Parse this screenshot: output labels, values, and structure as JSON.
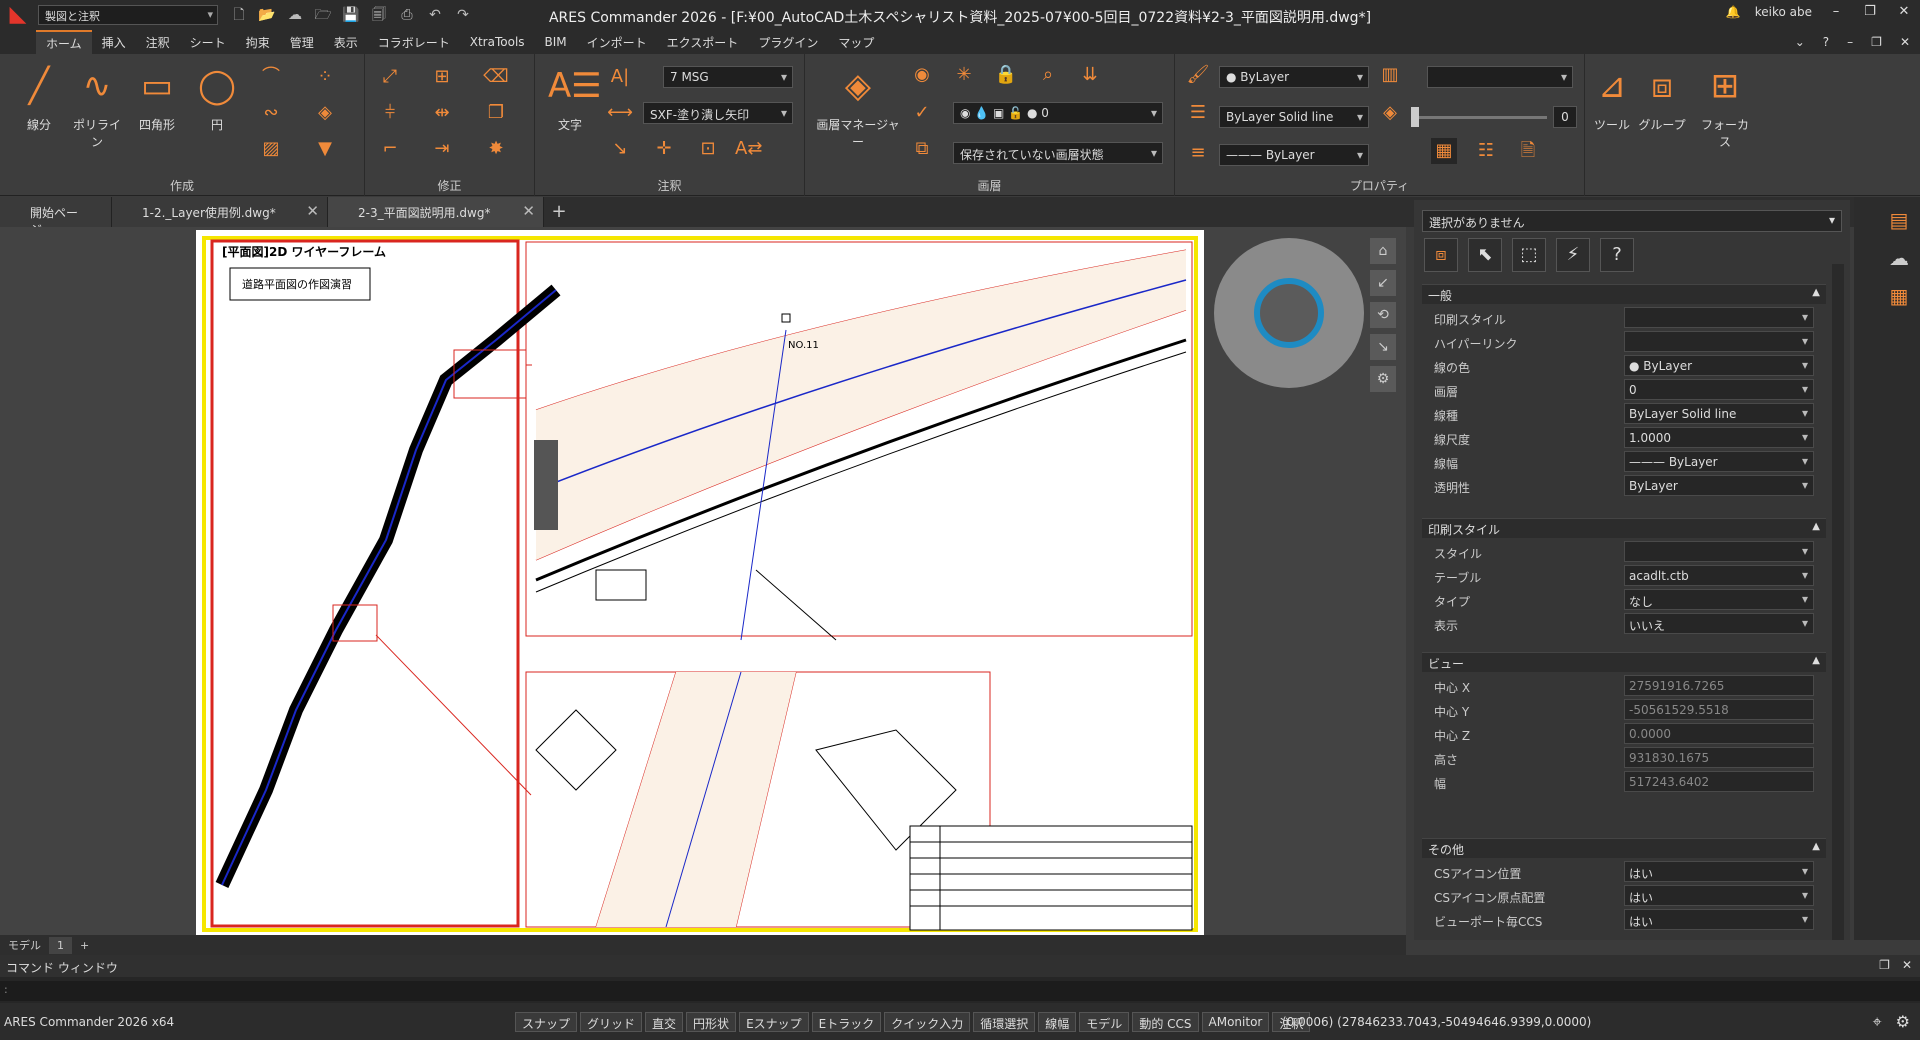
{
  "window": {
    "title": "ARES Commander 2026 - [F:¥00_AutoCAD土木スペシャリスト資料_2025-07¥00-5回目_0722資料¥2-3_平面図説明用.dwg*]",
    "workspace": "製図と注釈",
    "user": "keiko abe"
  },
  "ribbon_tabs": [
    "ホーム",
    "挿入",
    "注釈",
    "シート",
    "拘束",
    "管理",
    "表示",
    "コラボレート",
    "XtraTools",
    "BIM",
    "インポート",
    "エクスポート",
    "プラグイン",
    "マップ"
  ],
  "panels": {
    "create": {
      "label": "作成",
      "tools": [
        "線分",
        "ポリライン",
        "四角形",
        "円"
      ]
    },
    "modify": {
      "label": "修正"
    },
    "annotate": {
      "label": "注釈",
      "text": "文字",
      "textstyle": "7 MSG",
      "dimstyle": "SXF-塗り潰し矢印"
    },
    "layer": {
      "label": "画層",
      "manager": "画層マネージャー",
      "current": "0",
      "state": "保存されていない画層状態"
    },
    "props": {
      "label": "プロパティ",
      "color": "ByLayer",
      "linetype": "ByLayer    Solid line",
      "lineweight": "——— ByLayer",
      "transparency": "0"
    },
    "tools": {
      "label": "ツール"
    },
    "groups": {
      "label": "グループ"
    },
    "focus": {
      "label": "フォーカス"
    }
  },
  "doc_tabs": [
    {
      "label": "開始ページ"
    },
    {
      "label": "1-2._Layer使用例.dwg*"
    },
    {
      "label": "2-3_平面図説明用.dwg*",
      "active": true
    }
  ],
  "drawing": {
    "title": "[平面図]2D ワイヤーフレーム",
    "subtitle": "道路平面図の作図演習",
    "station": "NO.11"
  },
  "properties": {
    "selection": "選択がありません",
    "general": {
      "title": "一般",
      "rows": [
        [
          "印刷スタイル",
          ""
        ],
        [
          "ハイパーリンク",
          ""
        ],
        [
          "線の色",
          "● ByLayer"
        ],
        [
          "画層",
          "0"
        ],
        [
          "線種",
          "ByLayer    Solid line"
        ],
        [
          "線尺度",
          "1.0000"
        ],
        [
          "線幅",
          "——— ByLayer"
        ],
        [
          "透明性",
          "ByLayer"
        ]
      ]
    },
    "plotstyle": {
      "title": "印刷スタイル",
      "rows": [
        [
          "スタイル",
          ""
        ],
        [
          "テーブル",
          "acadlt.ctb"
        ],
        [
          "タイプ",
          "なし"
        ],
        [
          "表示",
          "いいえ"
        ]
      ]
    },
    "view": {
      "title": "ビュー",
      "rows": [
        [
          "中心 X",
          "27591916.7265"
        ],
        [
          "中心 Y",
          "-50561529.5518"
        ],
        [
          "中心 Z",
          "0.0000"
        ],
        [
          "高さ",
          "931830.1675"
        ],
        [
          "幅",
          "517243.6402"
        ]
      ]
    },
    "misc": {
      "title": "その他",
      "rows": [
        [
          "CSアイコン位置",
          "はい"
        ],
        [
          "CSアイコン原点配置",
          "はい"
        ],
        [
          "ビューポート毎CCS",
          "はい"
        ]
      ]
    }
  },
  "model_tabs": [
    "モデル",
    "1"
  ],
  "command": {
    "title": "コマンド ウィンドウ",
    "prompt": ":"
  },
  "status": {
    "app": "ARES Commander 2026 x64",
    "buttons": [
      "スナップ",
      "グリッド",
      "直交",
      "円形状",
      "Eスナップ",
      "Eトラック",
      "クイック入力",
      "循環選択",
      "線幅",
      "モデル",
      "動的 CCS",
      "AMonitor",
      "注釈"
    ],
    "coords": "(0.0006)  (27846233.7043,-50494646.9399,0.0000)"
  },
  "colors": {
    "accent": "#f08a3a",
    "frame_red": "#d9261f",
    "frame_yellow": "#f5e600",
    "nav_blue": "#1e8bc3"
  }
}
